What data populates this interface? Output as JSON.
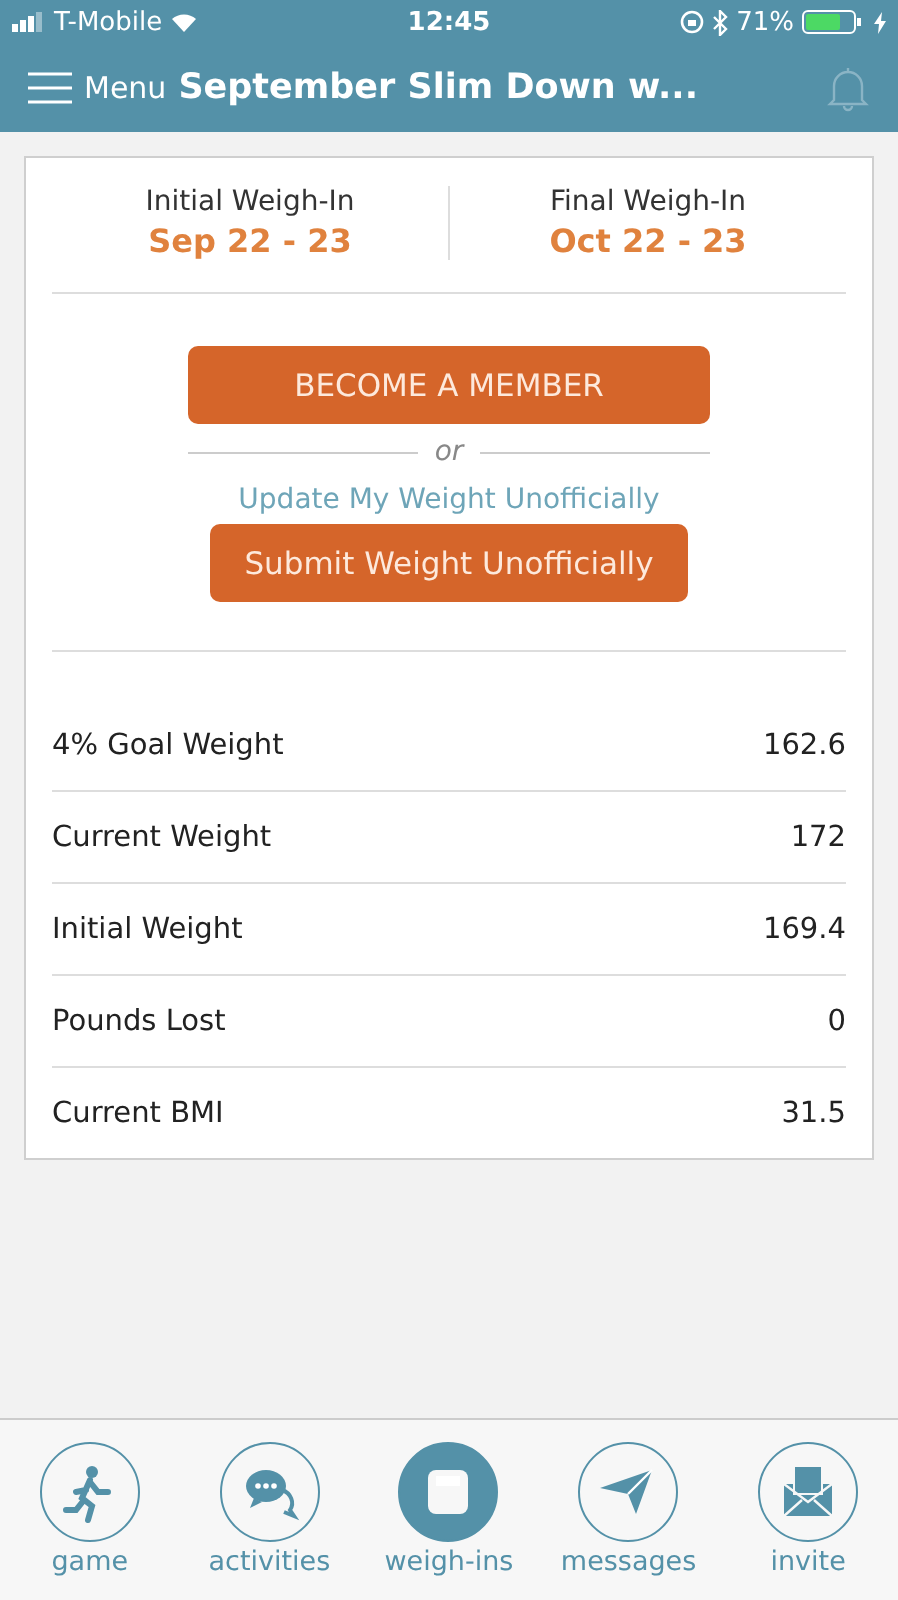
{
  "status_bar": {
    "carrier": "T-Mobile",
    "time": "12:45",
    "battery": "71%"
  },
  "header": {
    "menu_label": "Menu",
    "title": "September Slim Down w..."
  },
  "weigh_ins": [
    {
      "label": "Initial Weigh-In",
      "dates": "Sep 22 - 23"
    },
    {
      "label": "Final Weigh-In",
      "dates": "Oct 22 - 23"
    }
  ],
  "member_button": "BECOME A MEMBER",
  "divider_text": "or",
  "update_link": "Update My Weight Unofficially",
  "submit_button": "Submit Weight Unofficially",
  "stats": [
    {
      "label": "4% Goal Weight",
      "value": "162.6"
    },
    {
      "label": "Current Weight",
      "value": "172"
    },
    {
      "label": "Initial Weight",
      "value": "169.4"
    },
    {
      "label": "Pounds Lost",
      "value": "0"
    },
    {
      "label": "Current BMI",
      "value": "31.5"
    }
  ],
  "tabs": [
    {
      "kind": "game",
      "label": "game",
      "selected": false
    },
    {
      "kind": "activities",
      "label": "activities",
      "selected": false
    },
    {
      "kind": "weighins",
      "label": "weigh-ins",
      "selected": true
    },
    {
      "kind": "messages",
      "label": "messages",
      "selected": false
    },
    {
      "kind": "invite",
      "label": "invite",
      "selected": false
    }
  ]
}
